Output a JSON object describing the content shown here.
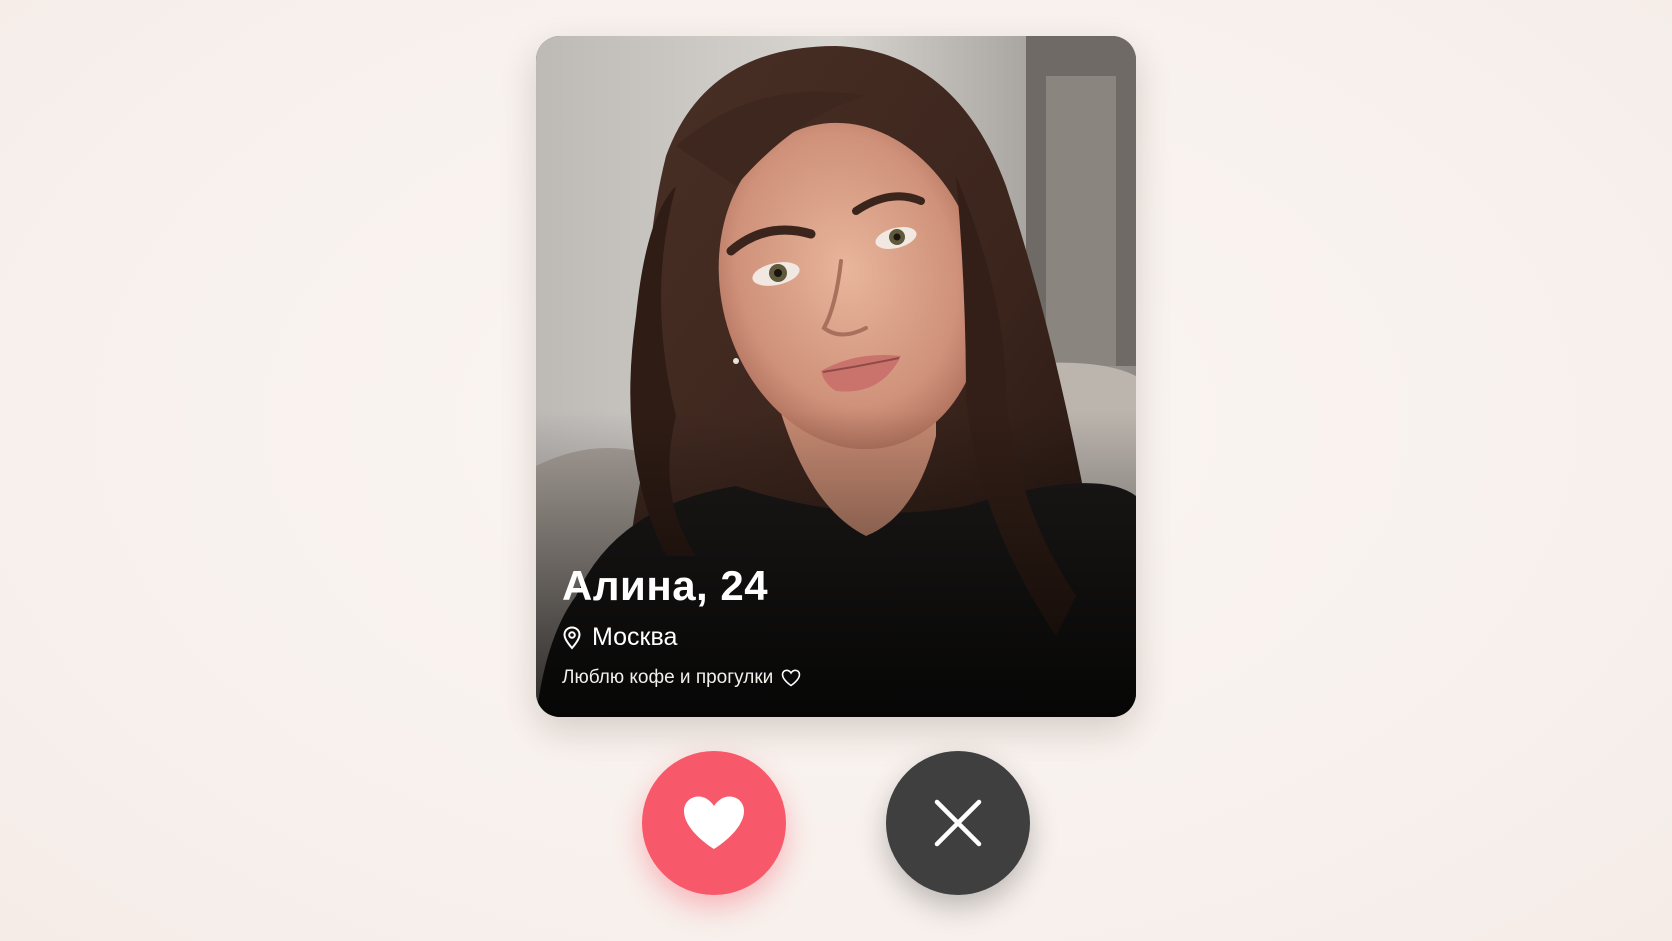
{
  "profile": {
    "name_age": "Алина, 24",
    "location": "Москва",
    "bio": "Люблю кофе и прогулки",
    "photo_icon": "profile-photo"
  },
  "actions": {
    "like_icon": "heart-icon",
    "dislike_icon": "close-icon"
  },
  "colors": {
    "like": "#f7586a",
    "dislike": "#3f3f40",
    "background": "#f8f1ed"
  }
}
